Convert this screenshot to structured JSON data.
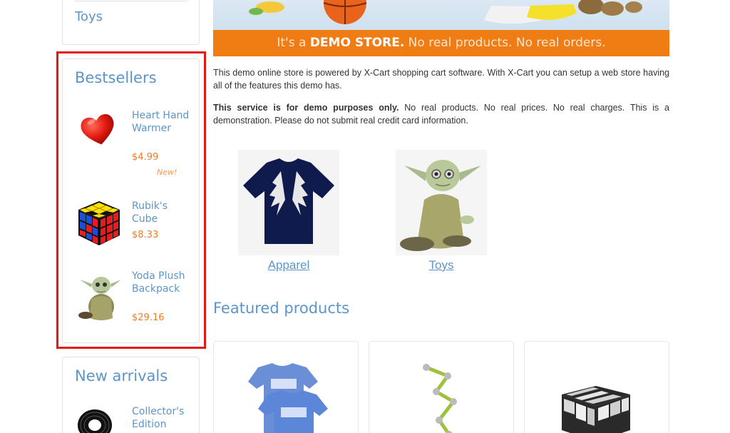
{
  "sidebar": {
    "categories_box": {
      "last_item": "Toys"
    },
    "bestsellers": {
      "title": "Bestsellers",
      "items": [
        {
          "name": "Heart Hand Warmer",
          "price": "$4.99",
          "badge": "New!",
          "icon": "heart-icon"
        },
        {
          "name": "Rubik's Cube",
          "price": "$8.33",
          "icon": "cube-icon"
        },
        {
          "name": "Yoda Plush Backpack",
          "price": "$29.16",
          "icon": "yoda-icon"
        }
      ]
    },
    "new_arrivals": {
      "title": "New arrivals",
      "items": [
        {
          "name": "Collector's Edition"
        }
      ]
    }
  },
  "main": {
    "demo_bar": {
      "prefix": "It's a ",
      "bold": "DEMO STORE.",
      "suffix": " No real products. No real orders."
    },
    "intro_1": "This demo online store is powered by X-Cart shopping cart software. With X-Cart you can setup a web store having all of the features this demo has.",
    "intro_2_bold": "This service is for demo purposes only.",
    "intro_2_rest": " No real products. No real prices. No real charges. This is a demonstration. Please do not submit real credit card information.",
    "categories": [
      {
        "label": "Apparel",
        "icon": "tshirt-icon"
      },
      {
        "label": "Toys",
        "icon": "yoda-icon"
      }
    ],
    "featured_title": "Featured products"
  },
  "colors": {
    "accent": "#5d95c8",
    "orange": "#f07d14",
    "price": "#f47a20",
    "highlight": "#e3161c"
  }
}
